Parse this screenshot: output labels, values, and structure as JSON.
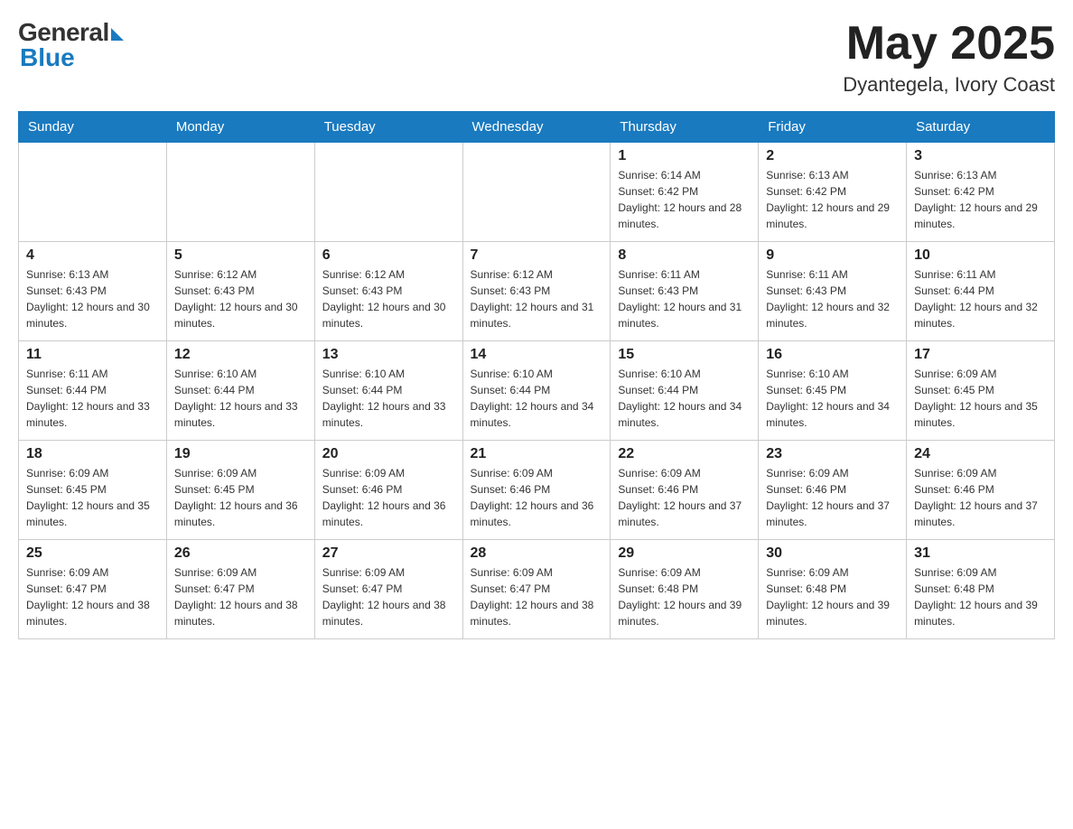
{
  "header": {
    "logo_general": "General",
    "logo_blue": "Blue",
    "month_title": "May 2025",
    "location": "Dyantegela, Ivory Coast"
  },
  "days_of_week": [
    "Sunday",
    "Monday",
    "Tuesday",
    "Wednesday",
    "Thursday",
    "Friday",
    "Saturday"
  ],
  "weeks": [
    [
      {
        "day": "",
        "info": ""
      },
      {
        "day": "",
        "info": ""
      },
      {
        "day": "",
        "info": ""
      },
      {
        "day": "",
        "info": ""
      },
      {
        "day": "1",
        "info": "Sunrise: 6:14 AM\nSunset: 6:42 PM\nDaylight: 12 hours and 28 minutes."
      },
      {
        "day": "2",
        "info": "Sunrise: 6:13 AM\nSunset: 6:42 PM\nDaylight: 12 hours and 29 minutes."
      },
      {
        "day": "3",
        "info": "Sunrise: 6:13 AM\nSunset: 6:42 PM\nDaylight: 12 hours and 29 minutes."
      }
    ],
    [
      {
        "day": "4",
        "info": "Sunrise: 6:13 AM\nSunset: 6:43 PM\nDaylight: 12 hours and 30 minutes."
      },
      {
        "day": "5",
        "info": "Sunrise: 6:12 AM\nSunset: 6:43 PM\nDaylight: 12 hours and 30 minutes."
      },
      {
        "day": "6",
        "info": "Sunrise: 6:12 AM\nSunset: 6:43 PM\nDaylight: 12 hours and 30 minutes."
      },
      {
        "day": "7",
        "info": "Sunrise: 6:12 AM\nSunset: 6:43 PM\nDaylight: 12 hours and 31 minutes."
      },
      {
        "day": "8",
        "info": "Sunrise: 6:11 AM\nSunset: 6:43 PM\nDaylight: 12 hours and 31 minutes."
      },
      {
        "day": "9",
        "info": "Sunrise: 6:11 AM\nSunset: 6:43 PM\nDaylight: 12 hours and 32 minutes."
      },
      {
        "day": "10",
        "info": "Sunrise: 6:11 AM\nSunset: 6:44 PM\nDaylight: 12 hours and 32 minutes."
      }
    ],
    [
      {
        "day": "11",
        "info": "Sunrise: 6:11 AM\nSunset: 6:44 PM\nDaylight: 12 hours and 33 minutes."
      },
      {
        "day": "12",
        "info": "Sunrise: 6:10 AM\nSunset: 6:44 PM\nDaylight: 12 hours and 33 minutes."
      },
      {
        "day": "13",
        "info": "Sunrise: 6:10 AM\nSunset: 6:44 PM\nDaylight: 12 hours and 33 minutes."
      },
      {
        "day": "14",
        "info": "Sunrise: 6:10 AM\nSunset: 6:44 PM\nDaylight: 12 hours and 34 minutes."
      },
      {
        "day": "15",
        "info": "Sunrise: 6:10 AM\nSunset: 6:44 PM\nDaylight: 12 hours and 34 minutes."
      },
      {
        "day": "16",
        "info": "Sunrise: 6:10 AM\nSunset: 6:45 PM\nDaylight: 12 hours and 34 minutes."
      },
      {
        "day": "17",
        "info": "Sunrise: 6:09 AM\nSunset: 6:45 PM\nDaylight: 12 hours and 35 minutes."
      }
    ],
    [
      {
        "day": "18",
        "info": "Sunrise: 6:09 AM\nSunset: 6:45 PM\nDaylight: 12 hours and 35 minutes."
      },
      {
        "day": "19",
        "info": "Sunrise: 6:09 AM\nSunset: 6:45 PM\nDaylight: 12 hours and 36 minutes."
      },
      {
        "day": "20",
        "info": "Sunrise: 6:09 AM\nSunset: 6:46 PM\nDaylight: 12 hours and 36 minutes."
      },
      {
        "day": "21",
        "info": "Sunrise: 6:09 AM\nSunset: 6:46 PM\nDaylight: 12 hours and 36 minutes."
      },
      {
        "day": "22",
        "info": "Sunrise: 6:09 AM\nSunset: 6:46 PM\nDaylight: 12 hours and 37 minutes."
      },
      {
        "day": "23",
        "info": "Sunrise: 6:09 AM\nSunset: 6:46 PM\nDaylight: 12 hours and 37 minutes."
      },
      {
        "day": "24",
        "info": "Sunrise: 6:09 AM\nSunset: 6:46 PM\nDaylight: 12 hours and 37 minutes."
      }
    ],
    [
      {
        "day": "25",
        "info": "Sunrise: 6:09 AM\nSunset: 6:47 PM\nDaylight: 12 hours and 38 minutes."
      },
      {
        "day": "26",
        "info": "Sunrise: 6:09 AM\nSunset: 6:47 PM\nDaylight: 12 hours and 38 minutes."
      },
      {
        "day": "27",
        "info": "Sunrise: 6:09 AM\nSunset: 6:47 PM\nDaylight: 12 hours and 38 minutes."
      },
      {
        "day": "28",
        "info": "Sunrise: 6:09 AM\nSunset: 6:47 PM\nDaylight: 12 hours and 38 minutes."
      },
      {
        "day": "29",
        "info": "Sunrise: 6:09 AM\nSunset: 6:48 PM\nDaylight: 12 hours and 39 minutes."
      },
      {
        "day": "30",
        "info": "Sunrise: 6:09 AM\nSunset: 6:48 PM\nDaylight: 12 hours and 39 minutes."
      },
      {
        "day": "31",
        "info": "Sunrise: 6:09 AM\nSunset: 6:48 PM\nDaylight: 12 hours and 39 minutes."
      }
    ]
  ]
}
